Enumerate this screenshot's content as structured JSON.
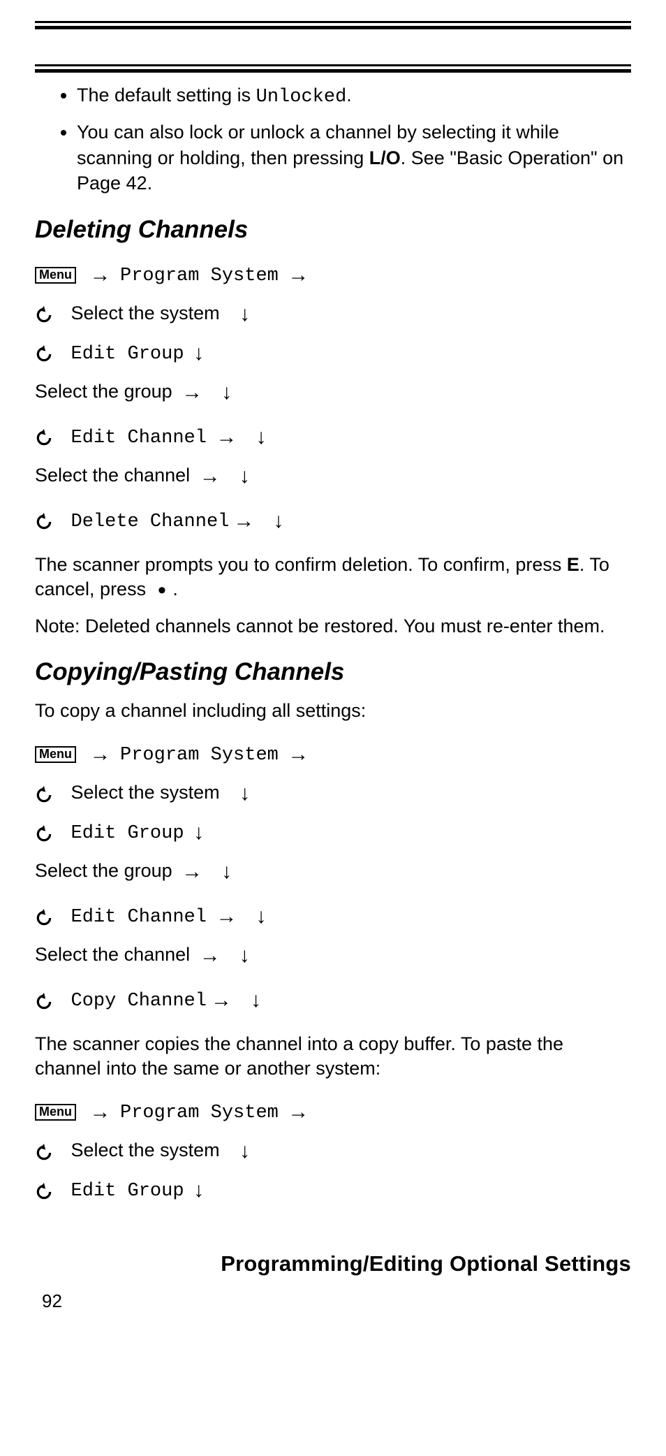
{
  "bullets": [
    {
      "pre": "The default setting is ",
      "mono": "Unlocked",
      "post": "."
    },
    {
      "text_parts": [
        "You can also lock or unlock a channel by selecting it while scanning or holding, then pressing ",
        "L/O",
        ". See \"Basic Operation\" on Page 42."
      ]
    }
  ],
  "h_del": "Deleting Channels",
  "h_copy": "Copying/Pasting Channels",
  "menu_label": "Menu",
  "steps": {
    "program_system": "Program System",
    "select_system": "Select the system",
    "edit_group": "Edit Group",
    "select_group": "Select the group",
    "edit_channel": "Edit Channel",
    "select_channel": "Select the channel",
    "delete_channel": "Delete Channel",
    "copy_channel": "Copy Channel"
  },
  "del_confirm1": "The scanner prompts you to confirm deletion. To confirm, press ",
  "del_confirm_e": "E",
  "del_confirm2": ". To cancel, press ",
  "del_confirm3": ".",
  "del_note": "Note: Deleted channels cannot be restored. You must re-enter them.",
  "copy_intro": "To copy a channel including all settings:",
  "copy_buffer": "The scanner copies the channel into a copy buffer. To paste the channel into the same or another system:",
  "footer_title": "Programming/Editing Optional Settings",
  "page_number": "92"
}
